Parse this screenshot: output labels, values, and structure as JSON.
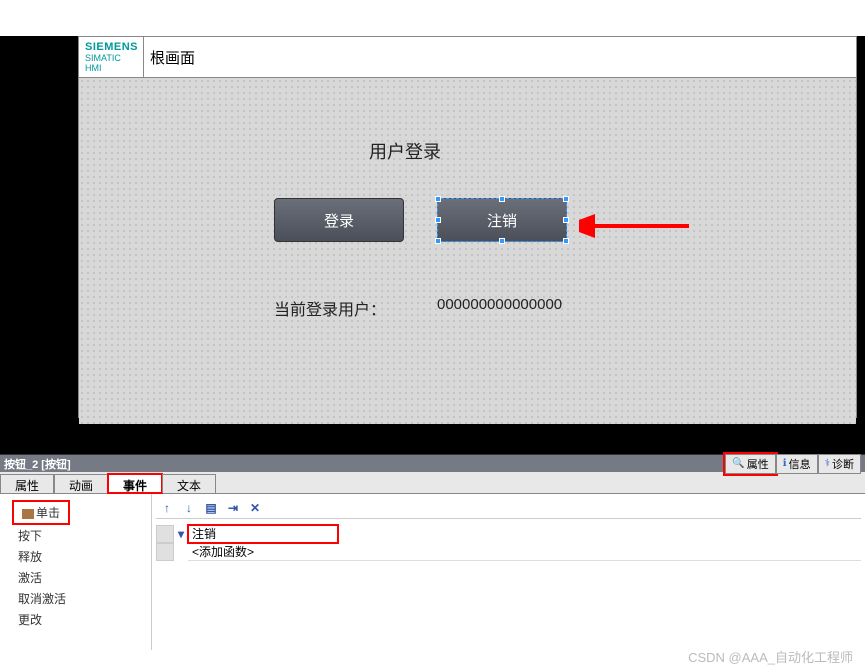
{
  "header": {
    "brand": "SIEMENS",
    "sub_brand": "SIMATIC HMI",
    "screen_title": "根画面"
  },
  "canvas": {
    "title": "用户登录",
    "login_btn": "登录",
    "logout_btn": "注销",
    "current_user_label": "当前登录用户：",
    "current_user_value": "000000000000000"
  },
  "object_bar": {
    "name": "按钮_2 [按钮]"
  },
  "panel_tabs": {
    "properties": "属性",
    "info": "信息",
    "diagnostics": "诊断"
  },
  "prop_tabs": {
    "properties": "属性",
    "animation": "动画",
    "events": "事件",
    "text": "文本"
  },
  "events": {
    "click": "单击",
    "press": "按下",
    "release": "释放",
    "activate": "激活",
    "deactivate": "取消激活",
    "change": "更改"
  },
  "functions": {
    "logout": "注销",
    "add_function": "<添加函数>"
  },
  "watermark": "CSDN @AAA_自动化工程师"
}
